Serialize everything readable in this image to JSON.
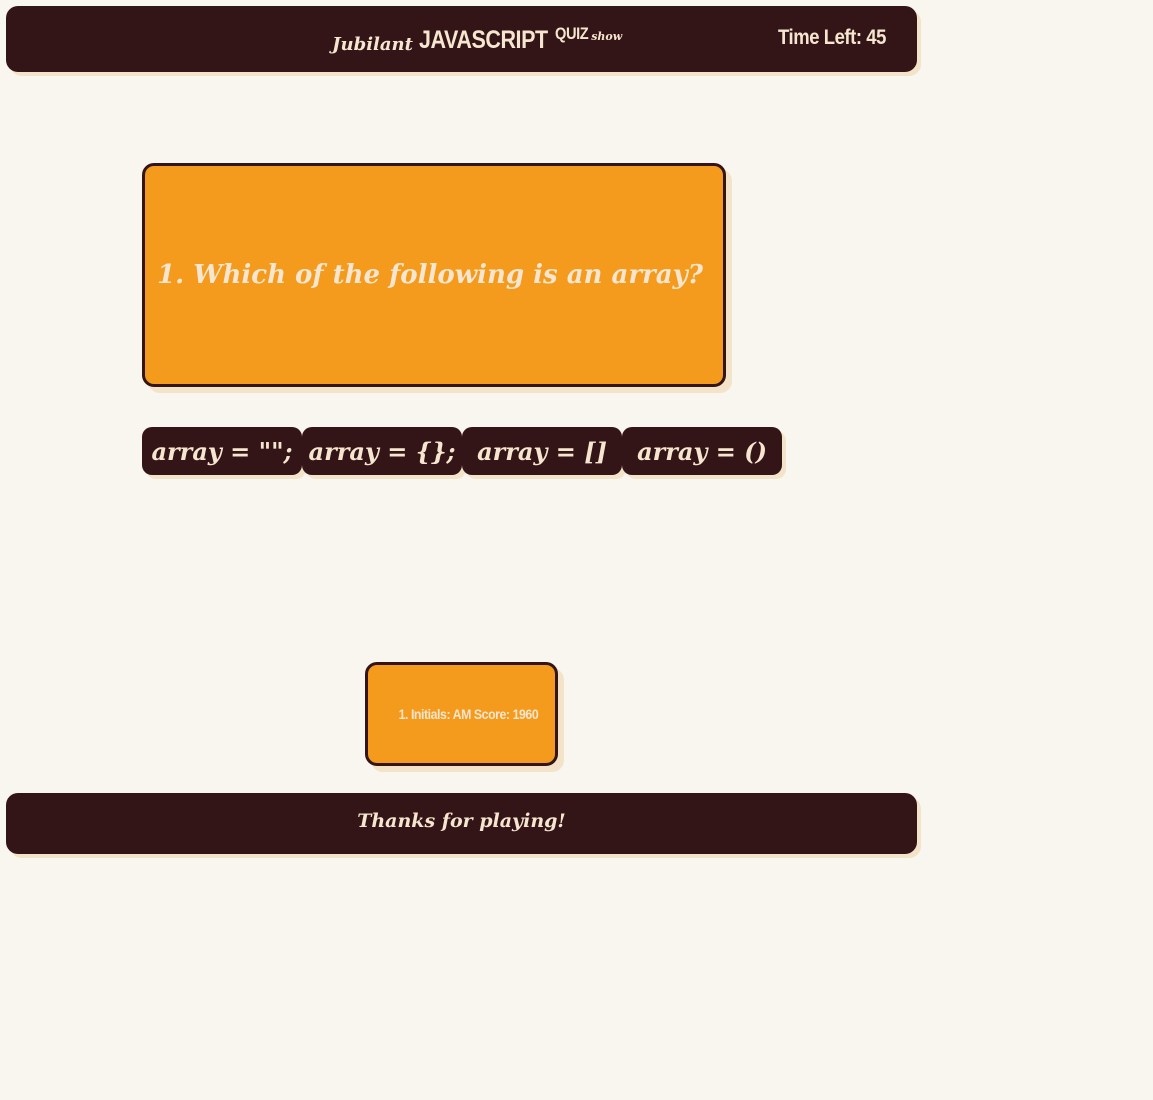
{
  "header": {
    "title_prefix": "Jubilant",
    "title_main": "JAVASCRIPT",
    "title_quiz": "QUIZ",
    "title_suffix": "show",
    "timer": "Time Left: 45"
  },
  "question": {
    "text": "1. Which of the following is an array?"
  },
  "answers": [
    {
      "label": "array = \"\";"
    },
    {
      "label": "array = {};"
    },
    {
      "label": "array = []"
    },
    {
      "label": "array = ()"
    }
  ],
  "scores": [
    {
      "text": "1. Initials: AM Score: 1960"
    }
  ],
  "footer": {
    "text": "Thanks for playing!"
  },
  "colors": {
    "dark": "#331517",
    "orange": "#f49a1d",
    "cream": "#f6e6cf",
    "background": "#f9f5ef"
  }
}
